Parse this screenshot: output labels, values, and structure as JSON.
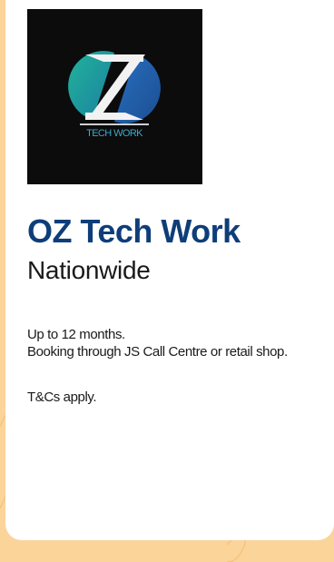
{
  "brand": {
    "logo_icon": "oz-tech-work-logo",
    "logo_wordmark": "TECH WORK",
    "colors": {
      "title_blue": "#0e3e79",
      "logo_teal": "#1fa68f",
      "logo_blue": "#1e5aa8",
      "page_background": "#fbd49a",
      "card_background": "#ffffff"
    }
  },
  "offer": {
    "title": "OZ Tech Work",
    "subtitle": "Nationwide",
    "description_lines": [
      "Up to 12 months.",
      "Booking through JS Call Centre or retail shop."
    ],
    "terms": "T&Cs apply."
  }
}
